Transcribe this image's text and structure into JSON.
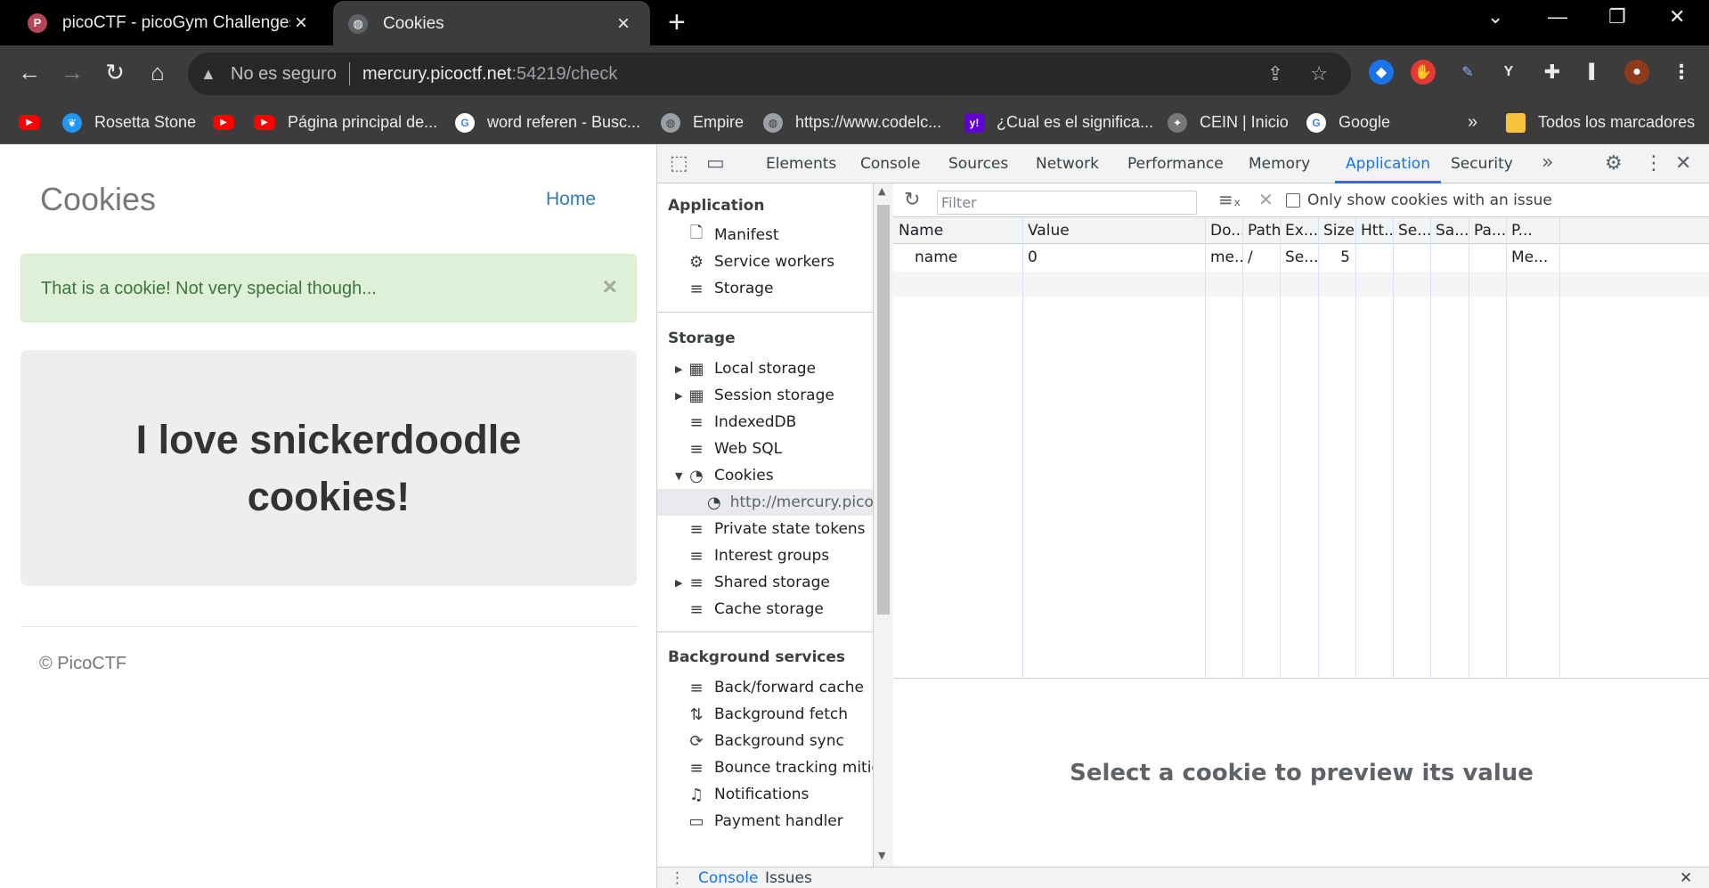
{
  "browser": {
    "tabs": [
      {
        "title": "picoCTF - picoGym Challenges",
        "favicon": "P"
      },
      {
        "title": "Cookies",
        "favicon": ""
      }
    ],
    "address": {
      "security_label": "No es seguro",
      "host": "mercury.picoctf.net",
      "path": ":54219/check"
    },
    "bookmarks": [
      {
        "label": "",
        "icon": "youtube-icon"
      },
      {
        "label": "Rosetta Stone",
        "icon": "rosetta-icon"
      },
      {
        "label": "",
        "icon": "youtube-icon"
      },
      {
        "label": "Página principal de...",
        "icon": "youtube-icon"
      },
      {
        "label": "word referen - Busc...",
        "icon": "google-icon"
      },
      {
        "label": "Empire",
        "icon": "globe-icon"
      },
      {
        "label": "https://www.codelc...",
        "icon": "globe-icon"
      },
      {
        "label": "¿Cual es el significa...",
        "icon": "yahoo-icon"
      },
      {
        "label": "CEIN | Inicio",
        "icon": "cein-icon"
      },
      {
        "label": "Google",
        "icon": "google-icon"
      }
    ],
    "bookmarks_overflow": "»",
    "all_bookmarks": "Todos los marcadores"
  },
  "page": {
    "brand": "Cookies",
    "home": "Home",
    "alert": "That is a cookie! Not very special though...",
    "alert_close": "×",
    "headline": "I love snickerdoodle cookies!",
    "footer": "© PicoCTF"
  },
  "devtools": {
    "tabs": [
      "Elements",
      "Console",
      "Sources",
      "Network",
      "Performance",
      "Memory",
      "Application",
      "Security"
    ],
    "active_tab": "Application",
    "more_tabs": "»",
    "sidebar": {
      "application_header": "Application",
      "application_items": [
        "Manifest",
        "Service workers",
        "Storage"
      ],
      "storage_header": "Storage",
      "storage_items": [
        "Local storage",
        "Session storage",
        "IndexedDB",
        "Web SQL",
        "Cookies",
        "http://mercury.picoc",
        "Private state tokens",
        "Interest groups",
        "Shared storage",
        "Cache storage"
      ],
      "background_header": "Background services",
      "background_items": [
        "Back/forward cache",
        "Background fetch",
        "Background sync",
        "Bounce tracking mitig",
        "Notifications",
        "Payment handler"
      ]
    },
    "cookies": {
      "filter_placeholder": "Filter",
      "only_issue_label": "Only show cookies with an issue",
      "columns": [
        "Name",
        "Value",
        "Do...",
        "Path",
        "Ex...",
        "Size",
        "Htt...",
        "Se...",
        "Sa...",
        "Pa...",
        "P..."
      ],
      "rows": [
        {
          "name": "name",
          "value": "0",
          "domain": "me...",
          "path": "/",
          "expires": "Se...",
          "size": "5",
          "httponly": "",
          "secure": "",
          "samesite": "",
          "partition": "",
          "priority": "Me..."
        }
      ],
      "preview_text": "Select a cookie to preview its value"
    },
    "drawer": {
      "tabs": [
        "Console",
        "Issues"
      ]
    }
  }
}
